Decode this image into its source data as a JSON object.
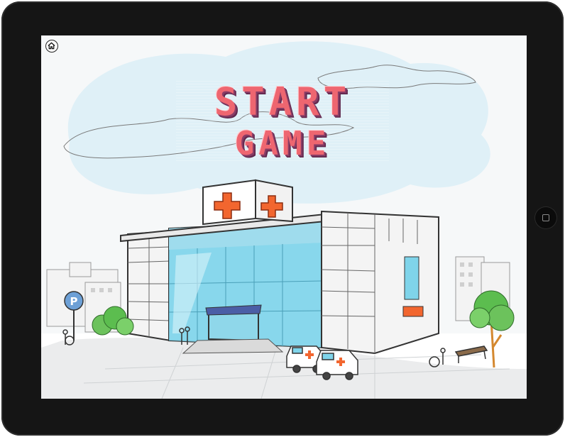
{
  "game": {
    "start_line1": "START",
    "start_line2": "GAME"
  },
  "icons": {
    "home": "home-icon",
    "tablet_home": "device-home-button"
  },
  "colors": {
    "title": "#ee6670",
    "title_shadow": "#6d2f57",
    "glass": "#7fd4ea",
    "cross": "#f2662f",
    "tree": "#5cbd4f"
  }
}
